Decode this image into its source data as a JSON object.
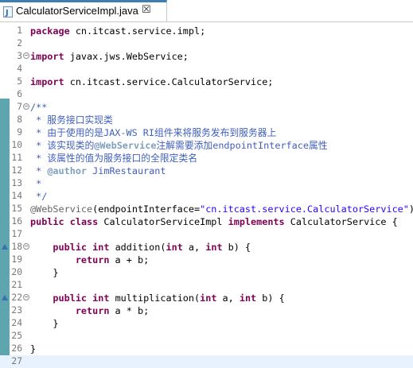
{
  "tab": {
    "title": "CalculatorServiceImpl.java",
    "close": "☒"
  },
  "editor": {
    "lines": [
      {
        "n": "1",
        "fold": false,
        "tokens": [
          {
            "t": "kw",
            "v": "package"
          },
          {
            "t": "",
            "v": " cn.itcast.service.impl;"
          }
        ]
      },
      {
        "n": "2",
        "fold": false,
        "tokens": []
      },
      {
        "n": "3",
        "fold": true,
        "tokens": [
          {
            "t": "kw",
            "v": "import"
          },
          {
            "t": "",
            "v": " javax.jws.WebService;"
          }
        ]
      },
      {
        "n": "4",
        "fold": false,
        "tokens": []
      },
      {
        "n": "5",
        "fold": false,
        "tokens": [
          {
            "t": "kw",
            "v": "import"
          },
          {
            "t": "",
            "v": " cn.itcast.service.CalculatorService;"
          }
        ]
      },
      {
        "n": "6",
        "fold": false,
        "tokens": []
      },
      {
        "n": "7",
        "fold": true,
        "tokens": [
          {
            "t": "cm",
            "v": "/**"
          }
        ]
      },
      {
        "n": "8",
        "fold": false,
        "tokens": [
          {
            "t": "cm",
            "v": " * 服务接口实现类"
          }
        ]
      },
      {
        "n": "9",
        "fold": false,
        "tokens": [
          {
            "t": "cm",
            "v": " * 由于使用的是JAX-WS RI组件来将服务发布到服务器上"
          }
        ]
      },
      {
        "n": "10",
        "fold": false,
        "tokens": [
          {
            "t": "cm",
            "v": " * 该实现类的"
          },
          {
            "t": "cmtag",
            "v": "@WebService"
          },
          {
            "t": "cm",
            "v": "注解需要添加endpointInterface属性"
          }
        ]
      },
      {
        "n": "11",
        "fold": false,
        "tokens": [
          {
            "t": "cm",
            "v": " * 该属性的值为服务接口的全限定类名"
          }
        ]
      },
      {
        "n": "12",
        "fold": false,
        "tokens": [
          {
            "t": "cm",
            "v": " * "
          },
          {
            "t": "cmtag",
            "v": "@author"
          },
          {
            "t": "cm",
            "v": " JimRestaurant"
          }
        ]
      },
      {
        "n": "13",
        "fold": false,
        "tokens": [
          {
            "t": "cm",
            "v": " *"
          }
        ]
      },
      {
        "n": "14",
        "fold": false,
        "tokens": [
          {
            "t": "cm",
            "v": " */"
          }
        ]
      },
      {
        "n": "15",
        "fold": false,
        "tokens": [
          {
            "t": "an",
            "v": "@WebService"
          },
          {
            "t": "",
            "v": "(endpointInterface="
          },
          {
            "t": "str",
            "v": "\"cn.itcast.service.CalculatorService\""
          },
          {
            "t": "",
            "v": ")"
          }
        ]
      },
      {
        "n": "16",
        "fold": false,
        "tokens": [
          {
            "t": "kw",
            "v": "public"
          },
          {
            "t": "",
            "v": " "
          },
          {
            "t": "kw",
            "v": "class"
          },
          {
            "t": "",
            "v": " CalculatorServiceImpl "
          },
          {
            "t": "kw",
            "v": "implements"
          },
          {
            "t": "",
            "v": " CalculatorService {"
          }
        ]
      },
      {
        "n": "17",
        "fold": false,
        "tokens": []
      },
      {
        "n": "18",
        "fold": true,
        "ann": true,
        "tokens": [
          {
            "t": "",
            "v": "    "
          },
          {
            "t": "kw",
            "v": "public"
          },
          {
            "t": "",
            "v": " "
          },
          {
            "t": "kw",
            "v": "int"
          },
          {
            "t": "",
            "v": " addition("
          },
          {
            "t": "kw",
            "v": "int"
          },
          {
            "t": "",
            "v": " a, "
          },
          {
            "t": "kw",
            "v": "int"
          },
          {
            "t": "",
            "v": " b) {"
          }
        ]
      },
      {
        "n": "19",
        "fold": false,
        "tokens": [
          {
            "t": "",
            "v": "        "
          },
          {
            "t": "kw",
            "v": "return"
          },
          {
            "t": "",
            "v": " a + b;"
          }
        ]
      },
      {
        "n": "20",
        "fold": false,
        "tokens": [
          {
            "t": "",
            "v": "    }"
          }
        ]
      },
      {
        "n": "21",
        "fold": false,
        "tokens": []
      },
      {
        "n": "22",
        "fold": true,
        "ann": true,
        "tokens": [
          {
            "t": "",
            "v": "    "
          },
          {
            "t": "kw",
            "v": "public"
          },
          {
            "t": "",
            "v": " "
          },
          {
            "t": "kw",
            "v": "int"
          },
          {
            "t": "",
            "v": " multiplication("
          },
          {
            "t": "kw",
            "v": "int"
          },
          {
            "t": "",
            "v": " a, "
          },
          {
            "t": "kw",
            "v": "int"
          },
          {
            "t": "",
            "v": " b) {"
          }
        ]
      },
      {
        "n": "23",
        "fold": false,
        "tokens": [
          {
            "t": "",
            "v": "        "
          },
          {
            "t": "kw",
            "v": "return"
          },
          {
            "t": "",
            "v": " a * b;"
          }
        ]
      },
      {
        "n": "24",
        "fold": false,
        "tokens": [
          {
            "t": "",
            "v": "    }"
          }
        ]
      },
      {
        "n": "25",
        "fold": false,
        "tokens": []
      },
      {
        "n": "26",
        "fold": false,
        "tokens": [
          {
            "t": "",
            "v": "}"
          }
        ]
      },
      {
        "n": "27",
        "fold": false,
        "current": true,
        "tokens": []
      }
    ]
  },
  "colors": {
    "keyword": "#7f0055",
    "comment": "#3f5fbf",
    "string": "#2a00ff",
    "annotation": "#646464",
    "gutter_change": "#5fa5b0"
  }
}
